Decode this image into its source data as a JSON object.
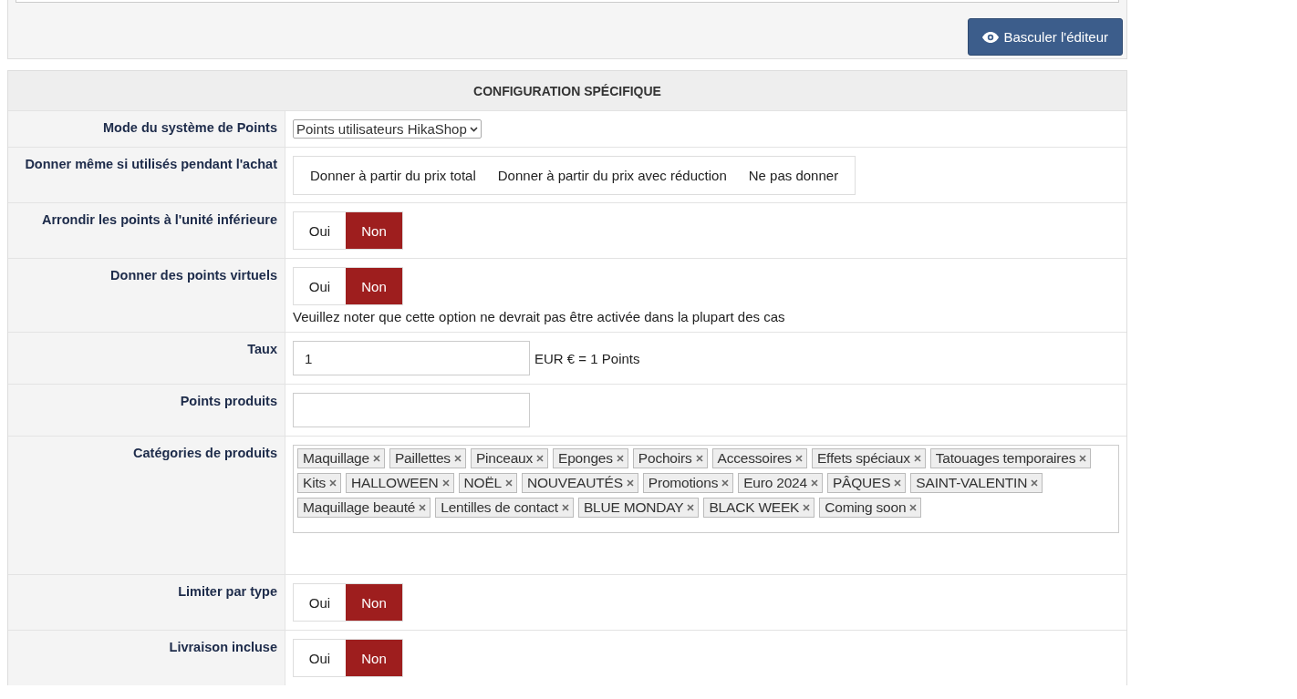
{
  "editor": {
    "toggle_button": "Basculer l'éditeur"
  },
  "config": {
    "title": "CONFIGURATION SPÉCIFIQUE",
    "rows": [
      {
        "kind": "select",
        "label": "Mode du système de Points",
        "value": "Points utilisateurs HikaShop"
      },
      {
        "kind": "radio",
        "label": "Donner même si utilisés pendant l'achat",
        "options": [
          {
            "label": "Donner à partir du prix total",
            "selected": false
          },
          {
            "label": "Donner à partir du prix avec réduction",
            "selected": false
          },
          {
            "label": "Ne pas donner",
            "selected": false
          }
        ]
      },
      {
        "kind": "toggle",
        "label": "Arrondir les points à l'unité inférieure",
        "options": [
          {
            "label": "Oui",
            "selected": false
          },
          {
            "label": "Non",
            "selected": true
          }
        ]
      },
      {
        "kind": "toggle",
        "label": "Donner des points virtuels",
        "options": [
          {
            "label": "Oui",
            "selected": false
          },
          {
            "label": "Non",
            "selected": true
          }
        ],
        "note": "Veuillez noter que cette option ne devrait pas être activée dans la plupart des cas"
      },
      {
        "kind": "text",
        "label": "Taux",
        "value": "1",
        "suffix": "EUR € = 1 Points"
      },
      {
        "kind": "text",
        "label": "Points produits"
      },
      {
        "kind": "tags",
        "label": "Catégories de produits",
        "tags": [
          "Maquillage",
          "Paillettes",
          "Pinceaux",
          "Eponges",
          "Pochoirs",
          "Accessoires",
          "Effets spéciaux",
          "Tatouages temporaires",
          "Kits",
          "HALLOWEEN",
          "NOËL",
          "NOUVEAUTÉS",
          "Promotions",
          "Euro 2024",
          "PÂQUES",
          "SAINT-VALENTIN",
          "Maquillage beauté",
          "Lentilles de contact",
          "BLUE MONDAY",
          "BLACK WEEK",
          "Coming soon"
        ]
      },
      {
        "kind": "toggle",
        "label": "Limiter par type",
        "options": [
          {
            "label": "Oui",
            "selected": false
          },
          {
            "label": "Non",
            "selected": true
          }
        ]
      },
      {
        "kind": "toggle",
        "label": "Livraison incluse",
        "options": [
          {
            "label": "Oui",
            "selected": false
          },
          {
            "label": "Non",
            "selected": true
          }
        ]
      }
    ]
  }
}
